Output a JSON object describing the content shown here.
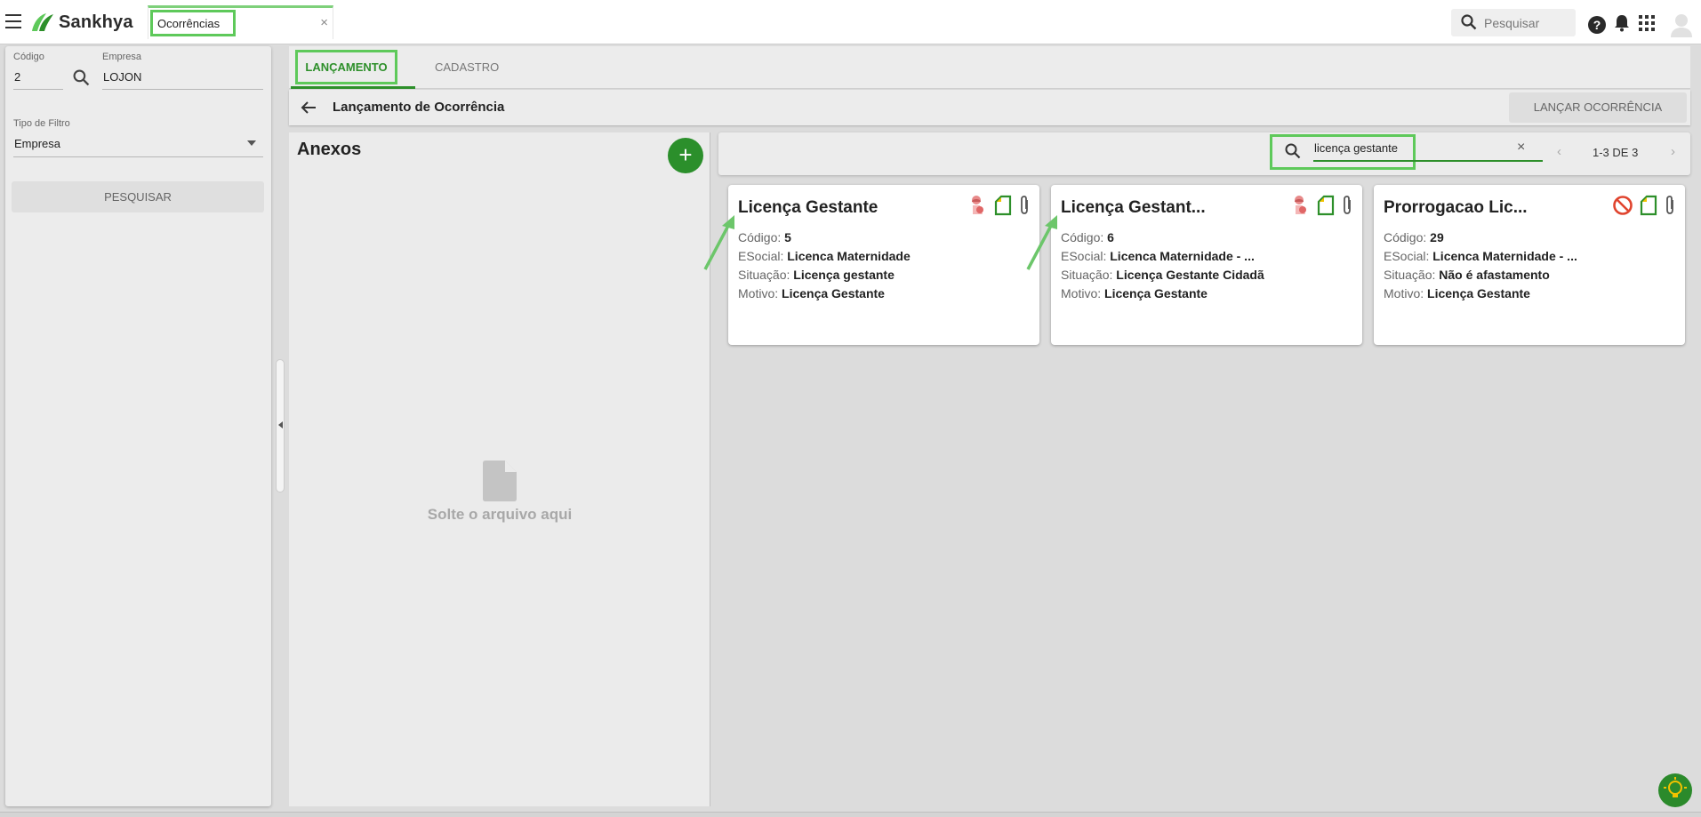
{
  "app": {
    "brand": "Sankhya",
    "accent_color": "#2d8f2a",
    "highlight_color": "#5ec95a"
  },
  "topbar": {
    "menu_icon": "hamburger-icon",
    "tab_label": "Ocorrências",
    "tab_close": "×",
    "search_placeholder": "Pesquisar",
    "icons": [
      "search-icon",
      "help-icon",
      "bell-icon",
      "apps-grid-icon",
      "user-avatar-icon"
    ]
  },
  "left_panel": {
    "codigo_label": "Código",
    "codigo_value": "2",
    "empresa_label": "Empresa",
    "empresa_value": "LOJON",
    "tipo_filtro_label": "Tipo de Filtro",
    "tipo_filtro_value": "Empresa",
    "pesquisar_button": "PESQUISAR"
  },
  "tabs": [
    {
      "label": "LANÇAMENTO",
      "active": true
    },
    {
      "label": "CADASTRO",
      "active": false
    }
  ],
  "header": {
    "title": "Lançamento de Ocorrência",
    "action_button": "LANÇAR OCORRÊNCIA"
  },
  "anexos": {
    "title": "Anexos",
    "add_label": "+",
    "drop_text": "Solte o arquivo aqui"
  },
  "filter": {
    "search_value": "licença gestante",
    "clear": "×",
    "pager_text": "1-3 DE 3",
    "prev": "‹",
    "next": "›"
  },
  "field_labels": {
    "codigo": "Código: ",
    "esocial": "ESocial: ",
    "situacao": "Situação: ",
    "motivo": "Motivo: "
  },
  "cards": [
    {
      "title": "Licença Gestante",
      "codigo": "5",
      "esocial": "Licenca Maternidade",
      "situacao": "Licença gestante",
      "motivo": "Licença Gestante",
      "status_icon": "maternity-icon"
    },
    {
      "title": "Licença Gestant...",
      "codigo": "6",
      "esocial": "Licenca Maternidade - ...",
      "situacao": "Licença Gestante Cidadã",
      "motivo": "Licença Gestante",
      "status_icon": "maternity-icon"
    },
    {
      "title": "Prorrogacao Lic...",
      "codigo": "29",
      "esocial": "Licenca Maternidade - ...",
      "situacao": "Não é afastamento",
      "motivo": "Licença Gestante",
      "status_icon": "prohibited-icon"
    }
  ]
}
